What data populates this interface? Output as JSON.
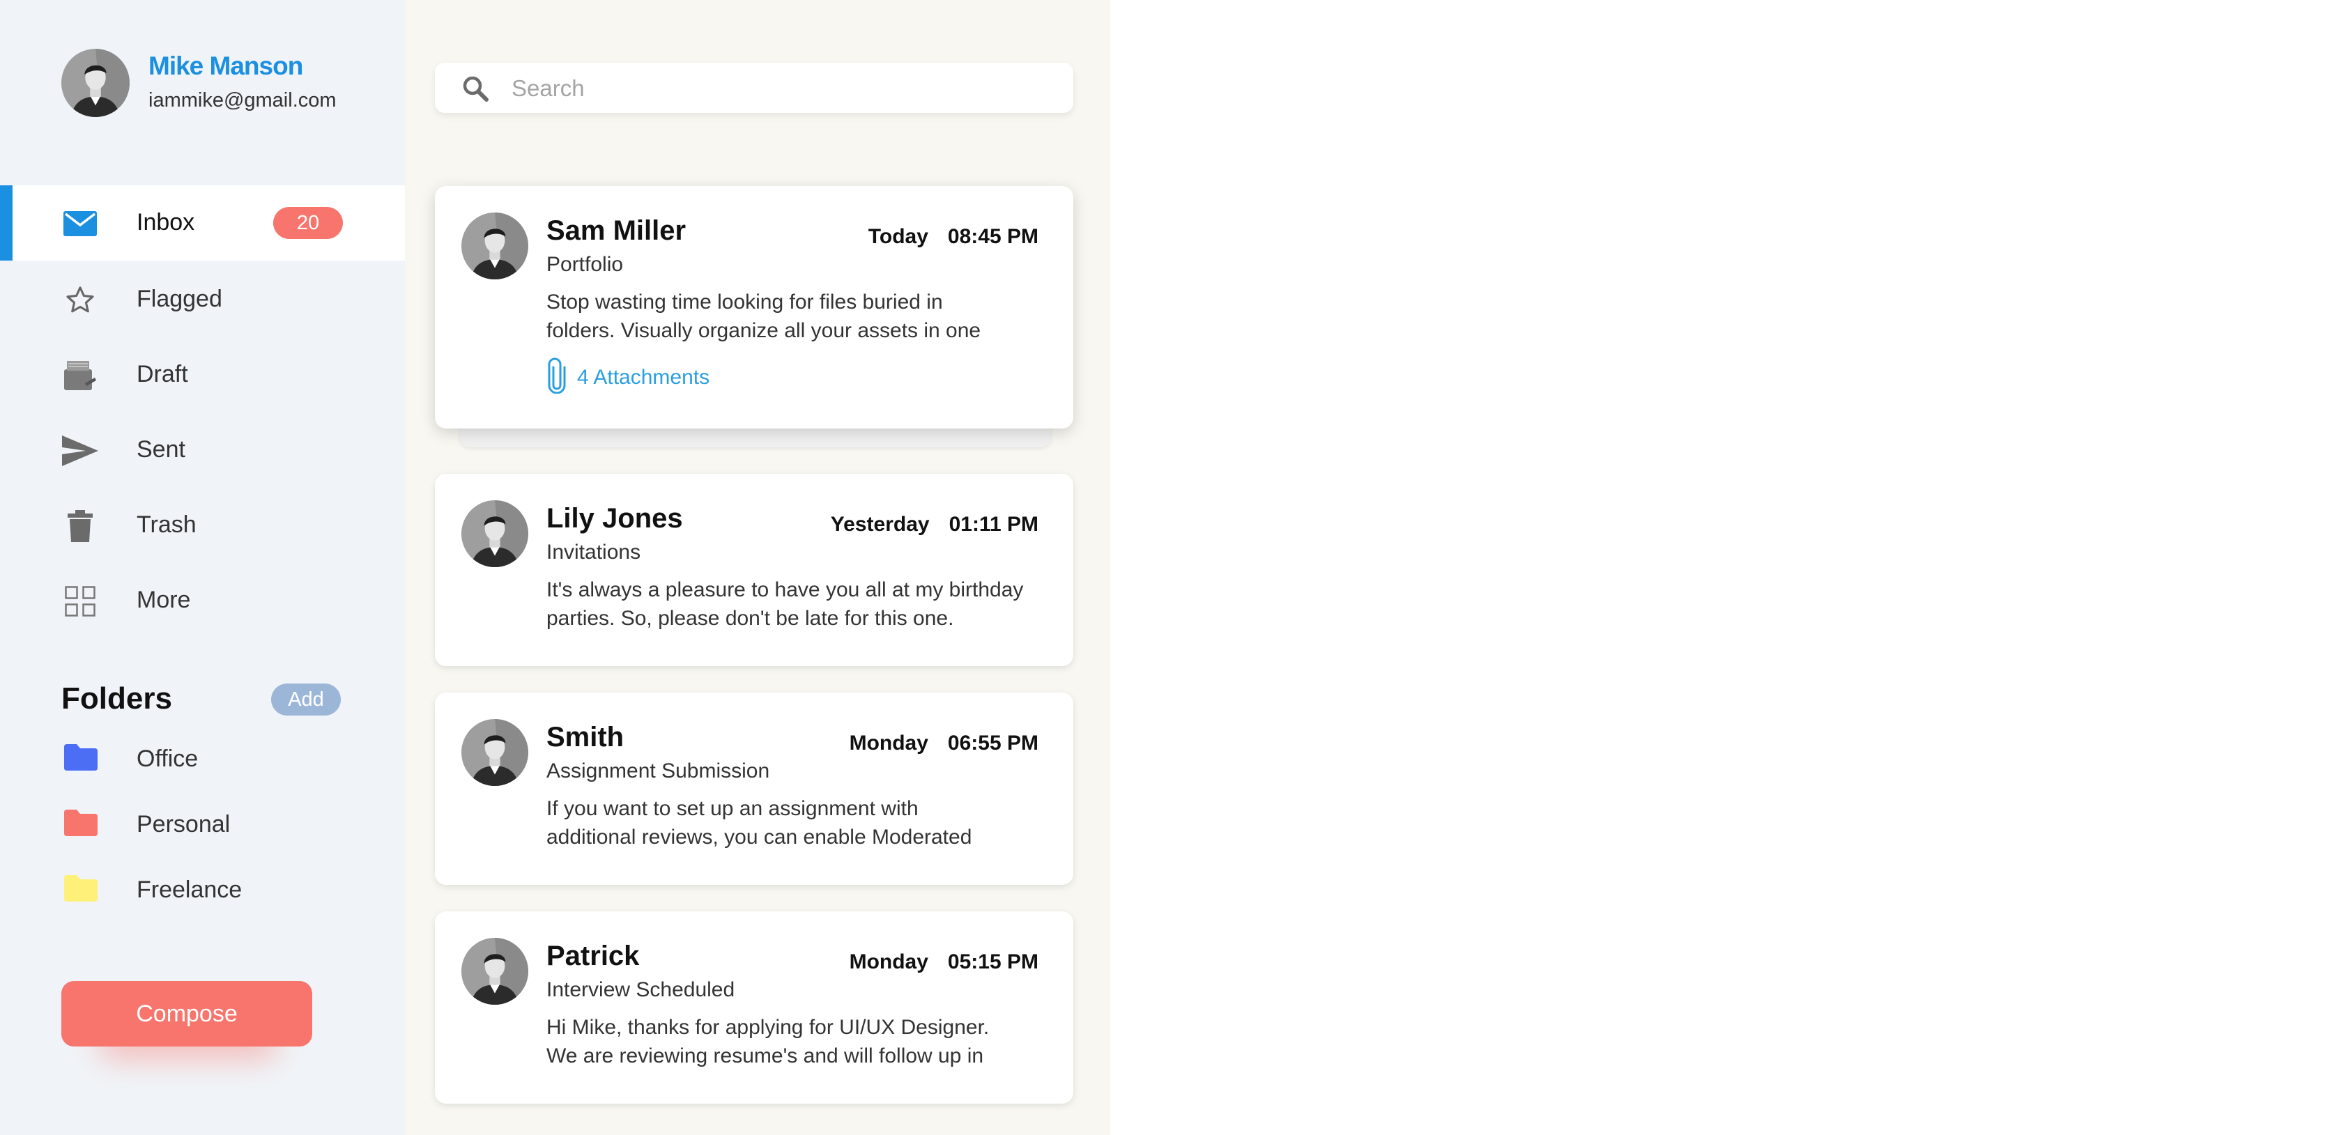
{
  "profile": {
    "name": "Mike Manson",
    "email": "iammike@gmail.com"
  },
  "nav": [
    {
      "label": "Inbox",
      "badge": "20",
      "icon": "mail-icon",
      "active": true
    },
    {
      "label": "Flagged",
      "icon": "star-icon"
    },
    {
      "label": "Draft",
      "icon": "draft-icon"
    },
    {
      "label": "Sent",
      "icon": "send-icon"
    },
    {
      "label": "Trash",
      "icon": "trash-icon"
    },
    {
      "label": "More",
      "icon": "grid-icon"
    }
  ],
  "folders": {
    "heading": "Folders",
    "add_label": "Add",
    "items": [
      {
        "label": "Office",
        "color": "#4c6ef5"
      },
      {
        "label": "Personal",
        "color": "#f7756c"
      },
      {
        "label": "Freelance",
        "color": "#fff07a"
      }
    ]
  },
  "compose_label": "Compose",
  "search": {
    "placeholder": "Search",
    "value": ""
  },
  "emails": [
    {
      "sender": "Sam Miller",
      "subject": "Portfolio",
      "day": "Today",
      "time": "08:45 PM",
      "preview_line1": "Stop wasting time looking for files buried in",
      "preview_line2": "folders. Visually organize all your assets in one",
      "attachments": "4 Attachments",
      "selected": true
    },
    {
      "sender": "Lily Jones",
      "subject": "Invitations",
      "day": "Yesterday",
      "time": "01:11 PM",
      "preview_line1": "It's always a pleasure to have you all at my birthday",
      "preview_line2": "parties. So, please don't be late for this one."
    },
    {
      "sender": "Smith",
      "subject": "Assignment Submission",
      "day": "Monday",
      "time": "06:55 PM",
      "preview_line1": "If you want to set up an assignment with",
      "preview_line2": "additional reviews, you can enable Moderated"
    },
    {
      "sender": "Patrick",
      "subject": "Interview Scheduled",
      "day": "Monday",
      "time": "05:15 PM",
      "preview_line1": "Hi Mike, thanks for applying for UI/UX Designer.",
      "preview_line2": "We are reviewing resume's and will follow up in"
    }
  ],
  "colors": {
    "accent": "#1b8fe0",
    "badge": "#f7756c",
    "add_button": "#9cb6d8",
    "sidebar_bg": "#f0f4f8",
    "list_bg": "#f8f7f1",
    "attachment_link": "#2a9fe0"
  }
}
